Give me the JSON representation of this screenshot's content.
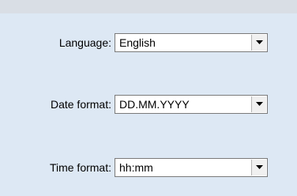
{
  "settings": {
    "language": {
      "label": "Language:",
      "value": "English",
      "icon": "chevron-down-icon"
    },
    "date_format": {
      "label": "Date format:",
      "value": "DD.MM.YYYY",
      "icon": "chevron-down-icon"
    },
    "time_format": {
      "label": "Time format:",
      "value": "hh:mm",
      "icon": "chevron-down-icon"
    }
  }
}
